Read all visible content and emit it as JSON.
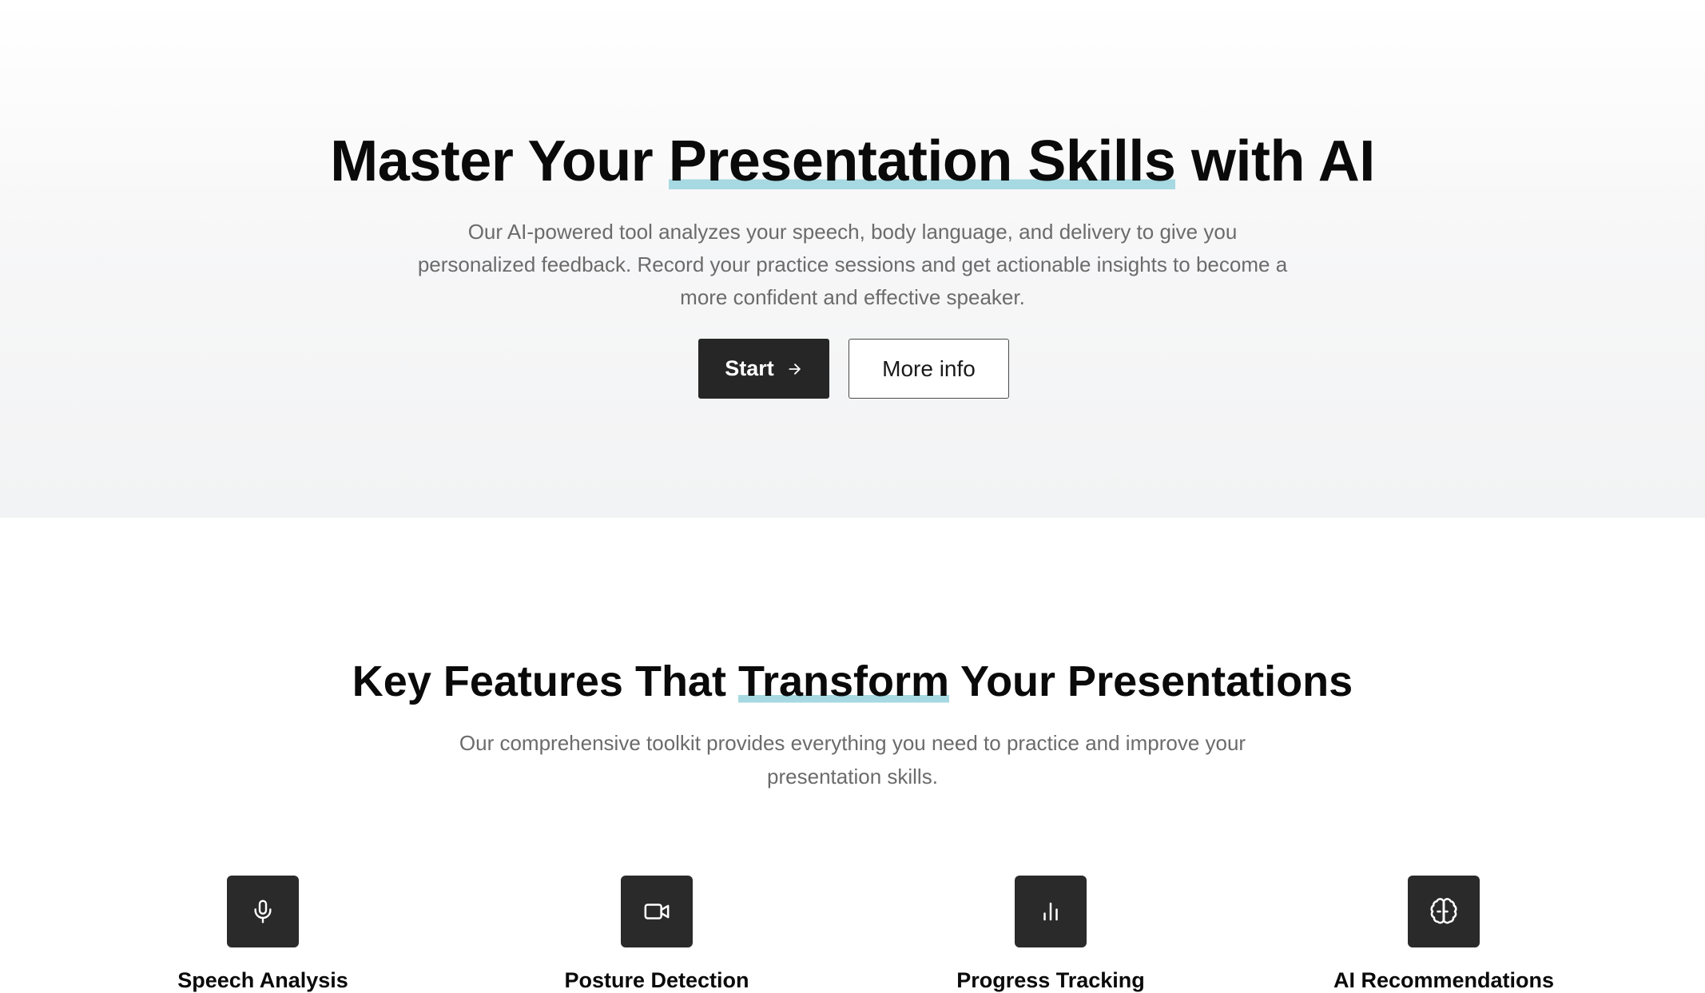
{
  "hero": {
    "title_before": "Master Your ",
    "title_highlight": "Presentation Skills",
    "title_after": " with AI",
    "description": "Our AI-powered tool analyzes your speech, body language, and delivery to give you personalized feedback. Record your practice sessions and get actionable insights to become a more confident and effective speaker.",
    "start_label": "Start",
    "more_info_label": "More info"
  },
  "features": {
    "title_before": "Key Features That ",
    "title_highlight": "Transform",
    "title_after": " Your Presentations",
    "description": "Our comprehensive toolkit provides everything you need to practice and improve your presentation skills.",
    "items": [
      {
        "title": "Speech Analysis",
        "icon": "microphone-icon"
      },
      {
        "title": "Posture Detection",
        "icon": "video-camera-icon"
      },
      {
        "title": "Progress Tracking",
        "icon": "bar-chart-icon"
      },
      {
        "title": "AI Recommendations",
        "icon": "brain-icon"
      }
    ]
  },
  "colors": {
    "highlight": "#a6d9e1",
    "button_dark": "#262626",
    "icon_tile": "#2a2a2a",
    "muted_text": "#6b6b6b"
  }
}
